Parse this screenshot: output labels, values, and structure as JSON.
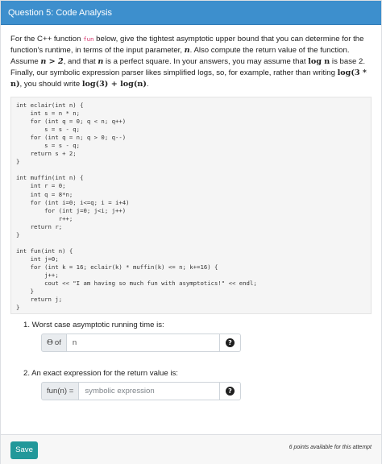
{
  "header": {
    "title": "Question 5: Code Analysis"
  },
  "prompt": {
    "p1": "For the C++ function ",
    "fn_name": "fun",
    "p2": " below, give the tightest asymptotic upper bound that you can determine for the function's runtime, in terms of the input parameter, ",
    "n1": "n",
    "p3": ". Also compute the return value of the function. Assume ",
    "cond1": "n > 2",
    "p4": ", and that ",
    "n2": "n",
    "p5": " is a perfect square. In your answers, you may assume that ",
    "log_n": "log n",
    "p6": " is base 2. Finally, our symbolic expression parser likes simplified logs, so, for example, rather than writing ",
    "ex_bad": "log(3 * n)",
    "p7": ", you should write ",
    "ex_good": "log(3) + log(n)",
    "p8": "."
  },
  "code": "int eclair(int n) {\n    int s = n * n;\n    for (int q = 0; q < n; q++)\n        s = s - q;\n    for (int q = n; q > 0; q--)\n        s = s - q;\n    return s + 2;\n}\n\nint muffin(int n) {\n    int r = 0;\n    int q = 8*n;\n    for (int i=0; i<=q; i = i+4)\n        for (int j=0; j<i; j++)\n            r++;\n    return r;\n}\n\nint fun(int n) {\n    int j=0;\n    for (int k = 16; eclair(k) * muffin(k) <= n; k+=16) {\n        j++;\n        cout << \"I am having so much fun with asymptotics!\" << endl;\n    }\n    return j;\n}",
  "q1": {
    "label": "1. Worst case asymptotic running time is:",
    "theta_symbol": "Θ",
    "prefix": "of",
    "value": "n",
    "help_icon": "?"
  },
  "q2": {
    "label": "2. An exact expression for the return value is:",
    "prefix": "fun(n) =",
    "placeholder": "symbolic expression",
    "help_icon": "?"
  },
  "footer": {
    "save_label": "Save",
    "points_text": "6 points available for this attempt"
  },
  "colors": {
    "header": "#3d8fcd",
    "save_button": "#22989a"
  }
}
